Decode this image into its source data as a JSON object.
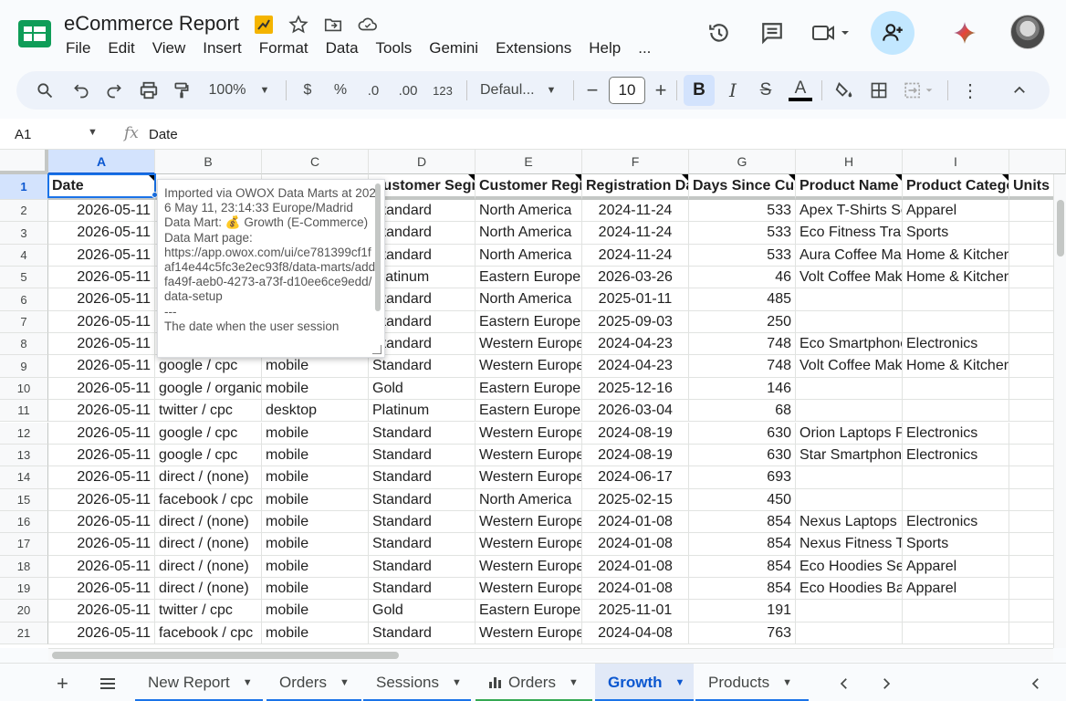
{
  "doc": {
    "title": "eCommerce Report"
  },
  "menu": [
    "File",
    "Edit",
    "View",
    "Insert",
    "Format",
    "Data",
    "Tools",
    "Gemini",
    "Extensions",
    "Help",
    "..."
  ],
  "toolbar": {
    "zoom": "100%",
    "currency": "$",
    "percent": "%",
    "dec_less": ".0",
    "dec_more": ".00",
    "number_fmt": "123",
    "font": "Defaul...",
    "font_size": "10",
    "bold": "B",
    "italic": "I",
    "strike": "S",
    "text_color": "A"
  },
  "formula_bar": {
    "cell_ref": "A1",
    "fx": "fx",
    "value": "Date"
  },
  "columns": [
    "A",
    "B",
    "C",
    "D",
    "E",
    "F",
    "G",
    "H",
    "I"
  ],
  "headers": [
    "Date",
    "",
    "",
    "Customer Segment",
    "Customer Region",
    "Registration Date",
    "Days Since Customer",
    "Product Name",
    "Product Category",
    "Units"
  ],
  "rows": [
    [
      "2026-05-11",
      "",
      "",
      "Standard",
      "North America",
      "2024-11-24",
      "533",
      "Apex T-Shirts Se",
      "Apparel"
    ],
    [
      "2026-05-11",
      "",
      "",
      "Standard",
      "North America",
      "2024-11-24",
      "533",
      "Eco Fitness Trac",
      "Sports"
    ],
    [
      "2026-05-11",
      "",
      "",
      "Standard",
      "North America",
      "2024-11-24",
      "533",
      "Aura Coffee Mak",
      "Home & Kitchen"
    ],
    [
      "2026-05-11",
      "",
      "",
      "Platinum",
      "Eastern Europe",
      "2026-03-26",
      "46",
      "Volt Coffee Make",
      "Home & Kitchen"
    ],
    [
      "2026-05-11",
      "",
      "",
      "Standard",
      "North America",
      "2025-01-11",
      "485",
      "",
      ""
    ],
    [
      "2026-05-11",
      "",
      "",
      "Standard",
      "Eastern Europe",
      "2025-09-03",
      "250",
      "",
      ""
    ],
    [
      "2026-05-11",
      "",
      "",
      "Standard",
      "Western Europe",
      "2024-04-23",
      "748",
      "Eco Smartphone",
      "Electronics"
    ],
    [
      "2026-05-11",
      "google / cpc",
      "mobile",
      "Standard",
      "Western Europe",
      "2024-04-23",
      "748",
      "Volt Coffee Make",
      "Home & Kitchen"
    ],
    [
      "2026-05-11",
      "google / organic",
      "mobile",
      "Gold",
      "Eastern Europe",
      "2025-12-16",
      "146",
      "",
      ""
    ],
    [
      "2026-05-11",
      "twitter / cpc",
      "desktop",
      "Platinum",
      "Eastern Europe",
      "2026-03-04",
      "68",
      "",
      ""
    ],
    [
      "2026-05-11",
      "google / cpc",
      "mobile",
      "Standard",
      "Western Europe",
      "2024-08-19",
      "630",
      "Orion Laptops P",
      "Electronics"
    ],
    [
      "2026-05-11",
      "google / cpc",
      "mobile",
      "Standard",
      "Western Europe",
      "2024-08-19",
      "630",
      "Star Smartphone",
      "Electronics"
    ],
    [
      "2026-05-11",
      "direct / (none)",
      "mobile",
      "Standard",
      "Western Europe",
      "2024-06-17",
      "693",
      "",
      ""
    ],
    [
      "2026-05-11",
      "facebook / cpc",
      "mobile",
      "Standard",
      "North America",
      "2025-02-15",
      "450",
      "",
      ""
    ],
    [
      "2026-05-11",
      "direct / (none)",
      "mobile",
      "Standard",
      "Western Europe",
      "2024-01-08",
      "854",
      "Nexus Laptops P",
      "Electronics"
    ],
    [
      "2026-05-11",
      "direct / (none)",
      "mobile",
      "Standard",
      "Western Europe",
      "2024-01-08",
      "854",
      "Nexus Fitness Tr",
      "Sports"
    ],
    [
      "2026-05-11",
      "direct / (none)",
      "mobile",
      "Standard",
      "Western Europe",
      "2024-01-08",
      "854",
      "Eco Hoodies Ser",
      "Apparel"
    ],
    [
      "2026-05-11",
      "direct / (none)",
      "mobile",
      "Standard",
      "Western Europe",
      "2024-01-08",
      "854",
      "Eco Hoodies Bas",
      "Apparel"
    ],
    [
      "2026-05-11",
      "twitter / cpc",
      "mobile",
      "Gold",
      "Eastern Europe",
      "2025-11-01",
      "191",
      "",
      ""
    ],
    [
      "2026-05-11",
      "facebook / cpc",
      "mobile",
      "Standard",
      "Western Europe",
      "2024-04-08",
      "763",
      "",
      ""
    ]
  ],
  "note": {
    "line1": "Imported via OWOX Data Marts at 2026 May 11, 23:14:33 Europe/Madrid",
    "line2": "Data Mart: 💰 Growth (E-Commerce)",
    "line3": "Data Mart page:",
    "line4": "https://app.owox.com/ui/ce781399cf1faf14e44c5fc3e2ec93f8/data-marts/addfa49f-aeb0-4273-a73f-d10ee6ce9edd/data-setup",
    "line5": "---",
    "line6": "The date when the user session"
  },
  "tabs": [
    {
      "label": "New Report",
      "color": "#1a73e8"
    },
    {
      "label": "Orders",
      "color": "#1a73e8"
    },
    {
      "label": "Sessions",
      "color": "#1a73e8"
    },
    {
      "label": "Orders",
      "color": "#34a853",
      "icon": "chart-icon"
    },
    {
      "label": "Growth",
      "color": "#1a73e8",
      "active": true
    },
    {
      "label": "Products",
      "color": "#1a73e8"
    }
  ]
}
